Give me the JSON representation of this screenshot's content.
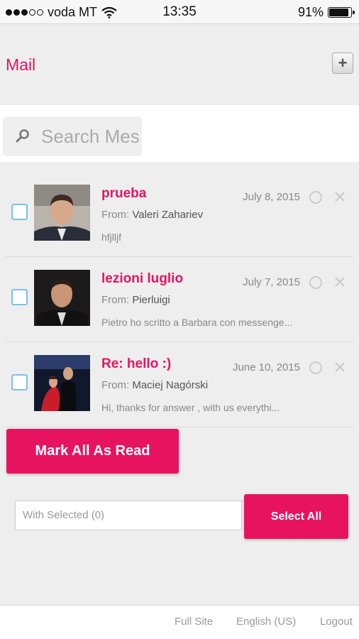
{
  "status_bar": {
    "carrier": "voda MT",
    "time": "13:35",
    "battery": "91%",
    "battery_level": 0.91,
    "signal_bars": 3,
    "signal_total": 5
  },
  "header": {
    "title": "Mail",
    "add_label": "+"
  },
  "search": {
    "placeholder": "Search Mes"
  },
  "messages": [
    {
      "subject": "prueba",
      "from_label": "From:",
      "from": "Valeri Zahariev",
      "preview": "hfjlljf",
      "date": "July 8, 2015"
    },
    {
      "subject": "lezioni luglio",
      "from_label": "From:",
      "from": "Pierluigi",
      "preview": "Pietro ho scritto a Barbara con messenge...",
      "date": "July 7, 2015"
    },
    {
      "subject": "Re: hello :)",
      "from_label": "From:",
      "from": "Maciej Nagórski",
      "preview": "Hi, thanks for answer , with us everythi...",
      "date": "June 10, 2015"
    }
  ],
  "actions": {
    "mark_all_read": "Mark All As Read",
    "with_selected": "With Selected (0)",
    "select_all": "Select All"
  },
  "footer": {
    "full_site": "Full Site",
    "language": "English (US)",
    "logout": "Logout"
  },
  "colors": {
    "accent": "#e8135f",
    "checkbox_border": "#7cc0e8"
  }
}
